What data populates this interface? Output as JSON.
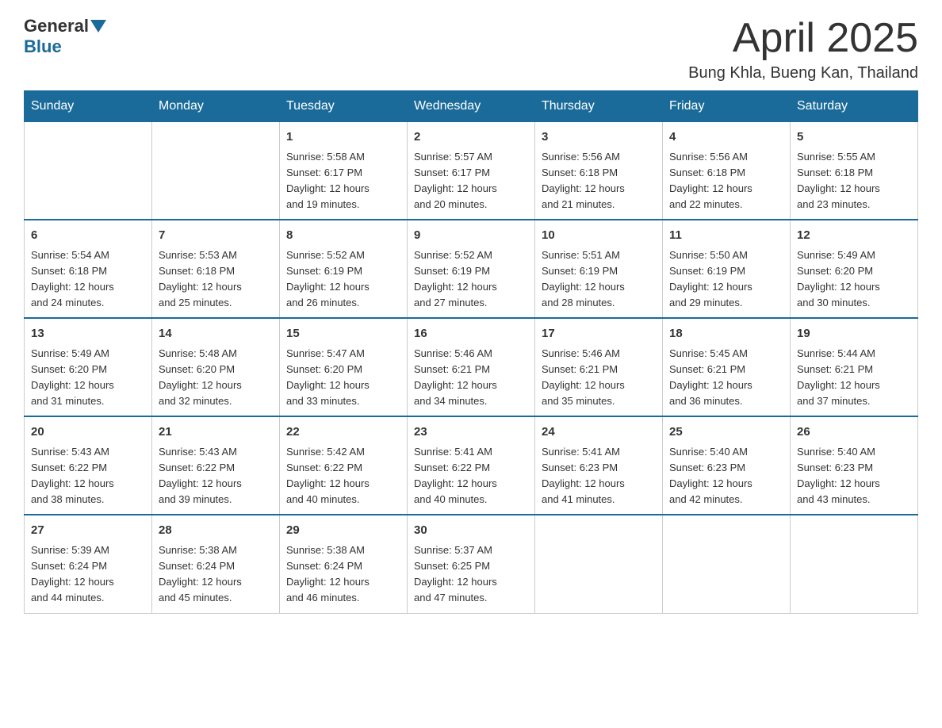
{
  "header": {
    "logo": {
      "general": "General",
      "blue": "Blue"
    },
    "title": "April 2025",
    "location": "Bung Khla, Bueng Kan, Thailand"
  },
  "days_of_week": [
    "Sunday",
    "Monday",
    "Tuesday",
    "Wednesday",
    "Thursday",
    "Friday",
    "Saturday"
  ],
  "weeks": [
    [
      {
        "day": "",
        "info": ""
      },
      {
        "day": "",
        "info": ""
      },
      {
        "day": "1",
        "info": "Sunrise: 5:58 AM\nSunset: 6:17 PM\nDaylight: 12 hours\nand 19 minutes."
      },
      {
        "day": "2",
        "info": "Sunrise: 5:57 AM\nSunset: 6:17 PM\nDaylight: 12 hours\nand 20 minutes."
      },
      {
        "day": "3",
        "info": "Sunrise: 5:56 AM\nSunset: 6:18 PM\nDaylight: 12 hours\nand 21 minutes."
      },
      {
        "day": "4",
        "info": "Sunrise: 5:56 AM\nSunset: 6:18 PM\nDaylight: 12 hours\nand 22 minutes."
      },
      {
        "day": "5",
        "info": "Sunrise: 5:55 AM\nSunset: 6:18 PM\nDaylight: 12 hours\nand 23 minutes."
      }
    ],
    [
      {
        "day": "6",
        "info": "Sunrise: 5:54 AM\nSunset: 6:18 PM\nDaylight: 12 hours\nand 24 minutes."
      },
      {
        "day": "7",
        "info": "Sunrise: 5:53 AM\nSunset: 6:18 PM\nDaylight: 12 hours\nand 25 minutes."
      },
      {
        "day": "8",
        "info": "Sunrise: 5:52 AM\nSunset: 6:19 PM\nDaylight: 12 hours\nand 26 minutes."
      },
      {
        "day": "9",
        "info": "Sunrise: 5:52 AM\nSunset: 6:19 PM\nDaylight: 12 hours\nand 27 minutes."
      },
      {
        "day": "10",
        "info": "Sunrise: 5:51 AM\nSunset: 6:19 PM\nDaylight: 12 hours\nand 28 minutes."
      },
      {
        "day": "11",
        "info": "Sunrise: 5:50 AM\nSunset: 6:19 PM\nDaylight: 12 hours\nand 29 minutes."
      },
      {
        "day": "12",
        "info": "Sunrise: 5:49 AM\nSunset: 6:20 PM\nDaylight: 12 hours\nand 30 minutes."
      }
    ],
    [
      {
        "day": "13",
        "info": "Sunrise: 5:49 AM\nSunset: 6:20 PM\nDaylight: 12 hours\nand 31 minutes."
      },
      {
        "day": "14",
        "info": "Sunrise: 5:48 AM\nSunset: 6:20 PM\nDaylight: 12 hours\nand 32 minutes."
      },
      {
        "day": "15",
        "info": "Sunrise: 5:47 AM\nSunset: 6:20 PM\nDaylight: 12 hours\nand 33 minutes."
      },
      {
        "day": "16",
        "info": "Sunrise: 5:46 AM\nSunset: 6:21 PM\nDaylight: 12 hours\nand 34 minutes."
      },
      {
        "day": "17",
        "info": "Sunrise: 5:46 AM\nSunset: 6:21 PM\nDaylight: 12 hours\nand 35 minutes."
      },
      {
        "day": "18",
        "info": "Sunrise: 5:45 AM\nSunset: 6:21 PM\nDaylight: 12 hours\nand 36 minutes."
      },
      {
        "day": "19",
        "info": "Sunrise: 5:44 AM\nSunset: 6:21 PM\nDaylight: 12 hours\nand 37 minutes."
      }
    ],
    [
      {
        "day": "20",
        "info": "Sunrise: 5:43 AM\nSunset: 6:22 PM\nDaylight: 12 hours\nand 38 minutes."
      },
      {
        "day": "21",
        "info": "Sunrise: 5:43 AM\nSunset: 6:22 PM\nDaylight: 12 hours\nand 39 minutes."
      },
      {
        "day": "22",
        "info": "Sunrise: 5:42 AM\nSunset: 6:22 PM\nDaylight: 12 hours\nand 40 minutes."
      },
      {
        "day": "23",
        "info": "Sunrise: 5:41 AM\nSunset: 6:22 PM\nDaylight: 12 hours\nand 40 minutes."
      },
      {
        "day": "24",
        "info": "Sunrise: 5:41 AM\nSunset: 6:23 PM\nDaylight: 12 hours\nand 41 minutes."
      },
      {
        "day": "25",
        "info": "Sunrise: 5:40 AM\nSunset: 6:23 PM\nDaylight: 12 hours\nand 42 minutes."
      },
      {
        "day": "26",
        "info": "Sunrise: 5:40 AM\nSunset: 6:23 PM\nDaylight: 12 hours\nand 43 minutes."
      }
    ],
    [
      {
        "day": "27",
        "info": "Sunrise: 5:39 AM\nSunset: 6:24 PM\nDaylight: 12 hours\nand 44 minutes."
      },
      {
        "day": "28",
        "info": "Sunrise: 5:38 AM\nSunset: 6:24 PM\nDaylight: 12 hours\nand 45 minutes."
      },
      {
        "day": "29",
        "info": "Sunrise: 5:38 AM\nSunset: 6:24 PM\nDaylight: 12 hours\nand 46 minutes."
      },
      {
        "day": "30",
        "info": "Sunrise: 5:37 AM\nSunset: 6:25 PM\nDaylight: 12 hours\nand 47 minutes."
      },
      {
        "day": "",
        "info": ""
      },
      {
        "day": "",
        "info": ""
      },
      {
        "day": "",
        "info": ""
      }
    ]
  ],
  "colors": {
    "header_bg": "#1a6b9a",
    "header_text": "#ffffff",
    "border": "#cccccc"
  }
}
